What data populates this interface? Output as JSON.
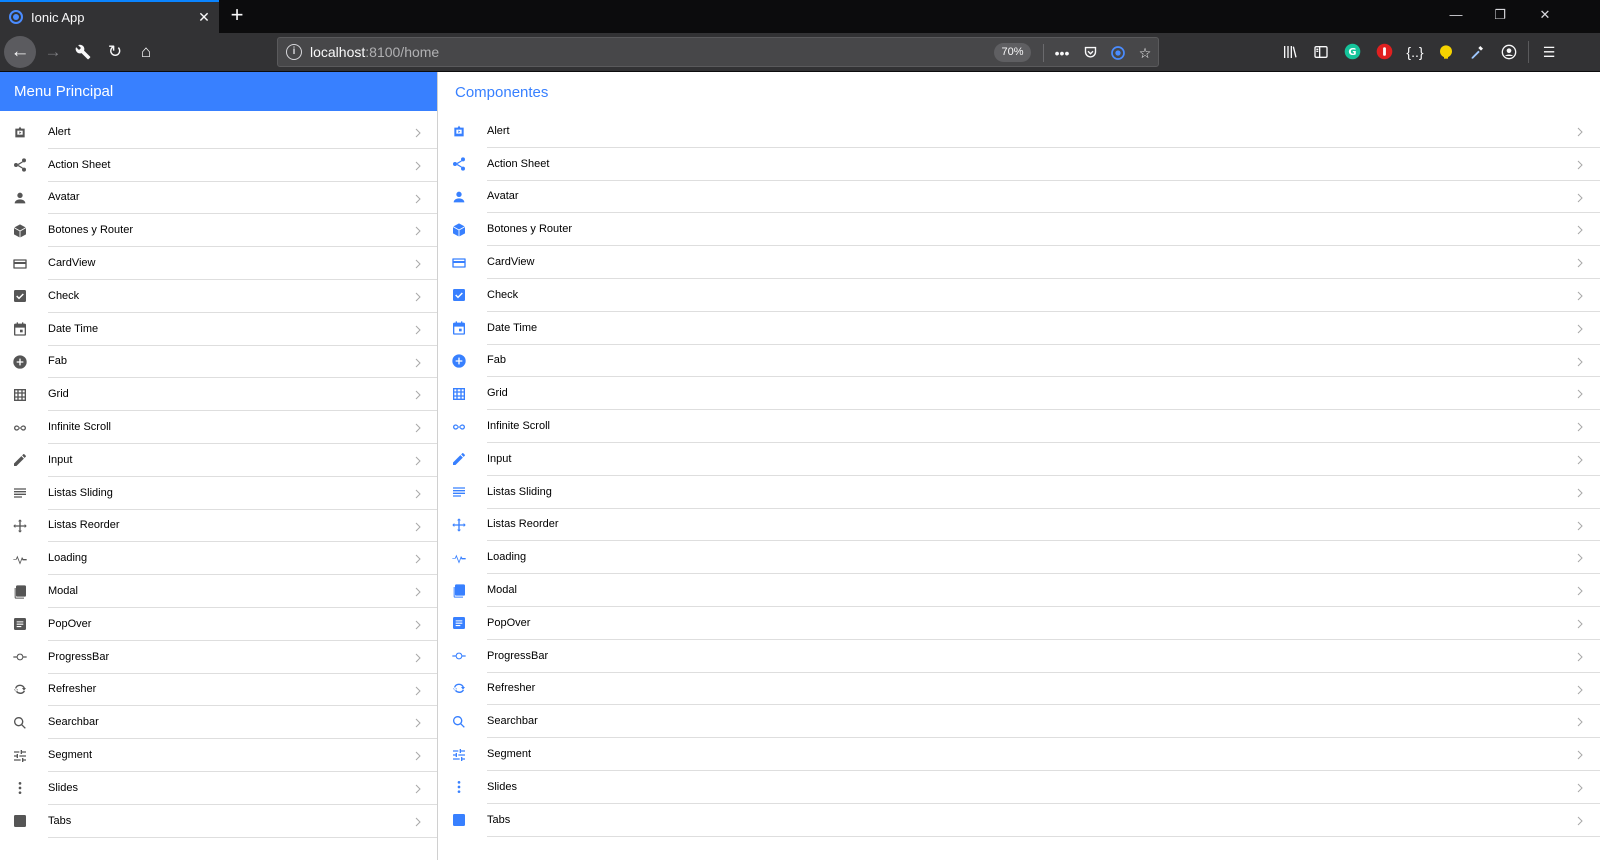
{
  "browser": {
    "tab_title": "Ionic App",
    "url_host": "localhost",
    "url_path": ":8100/home",
    "zoom": "70%",
    "accent_color": "#0a84ff"
  },
  "app": {
    "primary_color": "#3880ff",
    "menu_title": "Menu Principal",
    "content_title": "Componentes",
    "items": [
      {
        "label": "Alert",
        "icon": "american-football-icon"
      },
      {
        "label": "Action Sheet",
        "icon": "share-icon"
      },
      {
        "label": "Avatar",
        "icon": "person-icon"
      },
      {
        "label": "Botones y Router",
        "icon": "cube-icon"
      },
      {
        "label": "CardView",
        "icon": "card-icon"
      },
      {
        "label": "Check",
        "icon": "checkbox-icon"
      },
      {
        "label": "Date Time",
        "icon": "calendar-icon"
      },
      {
        "label": "Fab",
        "icon": "add-circle-icon"
      },
      {
        "label": "Grid",
        "icon": "grid-icon"
      },
      {
        "label": "Infinite Scroll",
        "icon": "infinite-icon"
      },
      {
        "label": "Input",
        "icon": "pencil-icon"
      },
      {
        "label": "Listas Sliding",
        "icon": "list-icon"
      },
      {
        "label": "Listas Reorder",
        "icon": "move-icon"
      },
      {
        "label": "Loading",
        "icon": "pulse-icon"
      },
      {
        "label": "Modal",
        "icon": "copy-icon"
      },
      {
        "label": "PopOver",
        "icon": "document-icon"
      },
      {
        "label": "ProgressBar",
        "icon": "git-commit-icon"
      },
      {
        "label": "Refresher",
        "icon": "refresh-icon"
      },
      {
        "label": "Searchbar",
        "icon": "search-icon"
      },
      {
        "label": "Segment",
        "icon": "options-icon"
      },
      {
        "label": "Slides",
        "icon": "more-vertical-icon"
      },
      {
        "label": "Tabs",
        "icon": "square-icon"
      }
    ]
  }
}
